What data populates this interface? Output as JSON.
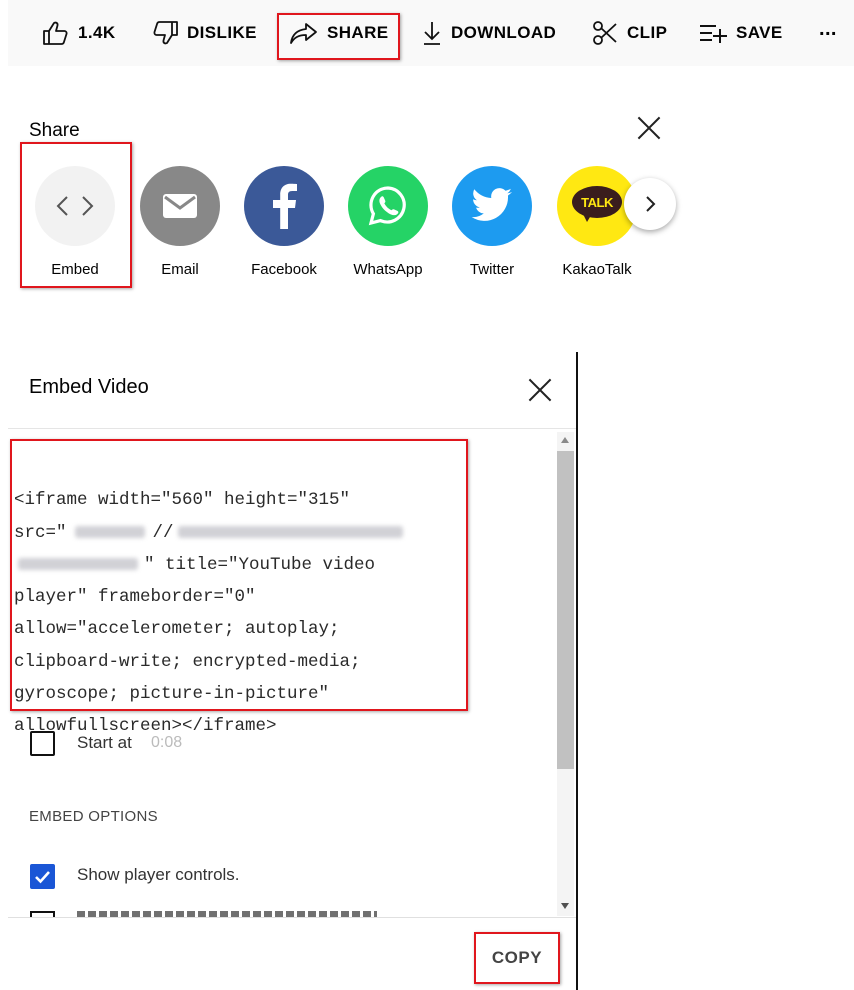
{
  "action_bar": {
    "like_count": "1.4K",
    "dislike_label": "DISLIKE",
    "share_label": "SHARE",
    "download_label": "DOWNLOAD",
    "clip_label": "CLIP",
    "save_label": "SAVE",
    "more_label": "..."
  },
  "share_dialog": {
    "title": "Share",
    "targets": [
      {
        "label": "Embed",
        "icon": "embed-code-icon",
        "color": "#f2f2f2"
      },
      {
        "label": "Email",
        "icon": "email-icon",
        "color": "#888888"
      },
      {
        "label": "Facebook",
        "icon": "facebook-icon",
        "color": "#3b5998"
      },
      {
        "label": "WhatsApp",
        "icon": "whatsapp-icon",
        "color": "#25d366"
      },
      {
        "label": "Twitter",
        "icon": "twitter-icon",
        "color": "#1d9bf0"
      },
      {
        "label": "KakaoTalk",
        "icon": "kakaotalk-icon",
        "color": "#ffe812",
        "icon_text": "TALK"
      }
    ]
  },
  "embed_dialog": {
    "title": "Embed Video",
    "code_lines": [
      "<iframe width=\"560\" height=\"315\"",
      "src=\"",
      "//",
      "\" title=\"YouTube video",
      "player\" frameborder=\"0\"",
      "allow=\"accelerometer; autoplay;",
      "clipboard-write; encrypted-media;",
      "gyroscope; picture-in-picture\"",
      "allowfullscreen></iframe>"
    ],
    "start_at_label": "Start at",
    "start_at_time": "0:08",
    "embed_options_heading": "EMBED OPTIONS",
    "show_controls_label": "Show player controls.",
    "copy_label": "COPY"
  },
  "colors": {
    "highlight": "#e0161d",
    "checkbox_checked": "#1a56d6"
  }
}
